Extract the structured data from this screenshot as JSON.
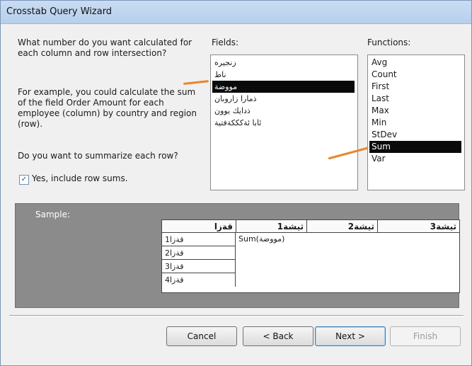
{
  "window": {
    "title": "Crosstab Query Wizard"
  },
  "prompt": {
    "question_lines": [
      "What number do you want calculated for",
      "each column and row intersection?"
    ],
    "example_lines": [
      "For example, you could calculate the sum",
      "of the field Order Amount for each",
      "employee (column)  by country and region",
      "(row)."
    ],
    "summarize_question": "Do you want to summarize each row?",
    "include_row_sums": {
      "checked": true,
      "label": "Yes, include row sums."
    }
  },
  "fields": {
    "label": "Fields:",
    "items": [
      "زنجيره",
      "ناط",
      "مووضة",
      "ذمارا زاروبان",
      "ذدايك يوون",
      "ئابا ئةكككةفتية"
    ],
    "selected": "مووضة"
  },
  "functions": {
    "label": "Functions:",
    "items": [
      "Avg",
      "Count",
      "First",
      "Last",
      "Max",
      "Min",
      "StDev",
      "Sum",
      "Var"
    ],
    "selected": "Sum"
  },
  "sample": {
    "label": "Sample:",
    "headers": [
      "قةزا",
      "ثيشة1",
      "ثيشة2",
      "ثيشة3"
    ],
    "rows": [
      "قةزا1",
      "قةزا2",
      "قةزا3",
      "قةزا4"
    ],
    "sum_text": "Sum(مووضة)"
  },
  "buttons": {
    "cancel": "Cancel",
    "back": "< Back",
    "next": "Next >",
    "finish": "Finish"
  },
  "colors": {
    "marker": "#e8862b",
    "selection": "#0a0a0a",
    "sample_panel": "#8b8b8b"
  }
}
